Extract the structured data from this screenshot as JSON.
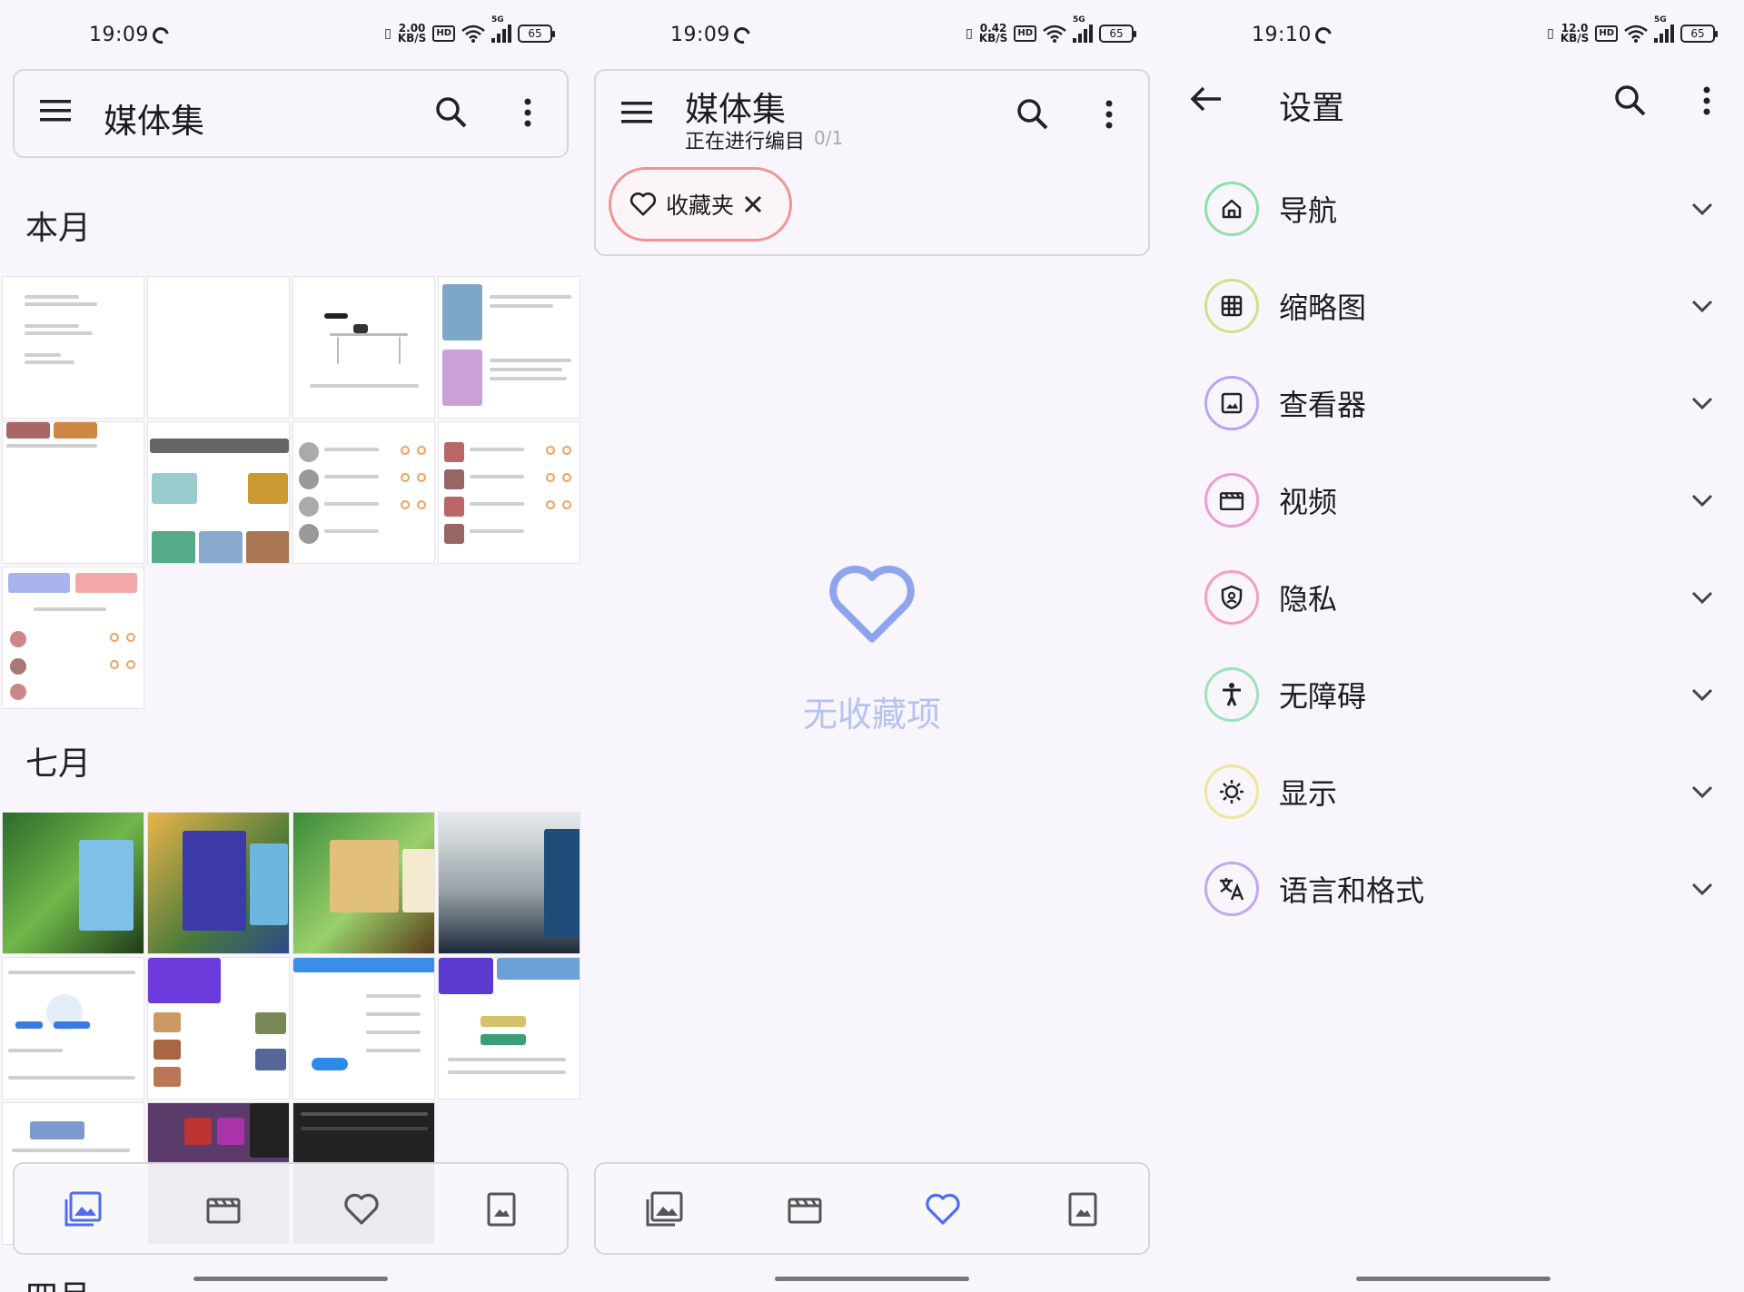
{
  "status_bars": [
    {
      "time": "19:09",
      "speed": "2.00",
      "speed_unit": "KB/S",
      "network": "5G",
      "battery": "65"
    },
    {
      "time": "19:09",
      "speed": "0.42",
      "speed_unit": "KB/S",
      "network": "5G",
      "battery": "65"
    },
    {
      "time": "19:10",
      "speed": "12.0",
      "speed_unit": "KB/S",
      "network": "5G",
      "battery": "65"
    }
  ],
  "hd_label": "HD",
  "gallery": {
    "title": "媒体集",
    "sections": [
      {
        "label": "本月"
      },
      {
        "label": "七月"
      },
      {
        "label": "四月"
      }
    ]
  },
  "favorites": {
    "title": "媒体集",
    "subtitle": "正在进行编目",
    "progress": "0/1",
    "chip_label": "收藏夹",
    "empty_text": "无收藏项"
  },
  "settings": {
    "title": "设置",
    "items": [
      {
        "label": "导航",
        "icon": "home-icon",
        "color": "#8fe0a7"
      },
      {
        "label": "缩略图",
        "icon": "grid-icon",
        "color": "#c9e48a"
      },
      {
        "label": "查看器",
        "icon": "image-icon",
        "color": "#b7a6f5"
      },
      {
        "label": "视频",
        "icon": "movie-icon",
        "color": "#f19bd4"
      },
      {
        "label": "隐私",
        "icon": "shield-icon",
        "color": "#f5a0b6"
      },
      {
        "label": "无障碍",
        "icon": "accessibility-icon",
        "color": "#9ee3b7"
      },
      {
        "label": "显示",
        "icon": "sun-icon",
        "color": "#f1e59b"
      },
      {
        "label": "语言和格式",
        "icon": "translate-icon",
        "color": "#c4a7ef"
      }
    ]
  },
  "nav_active_color": "#4f6cf0"
}
